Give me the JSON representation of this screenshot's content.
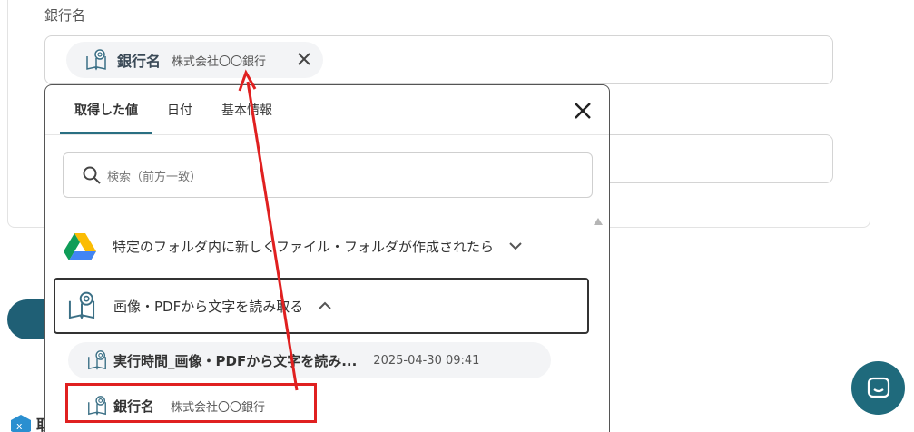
{
  "field": {
    "label": "銀行名",
    "chip": {
      "key": "銀行名",
      "value": "株式会社〇〇銀行"
    }
  },
  "popup": {
    "tabs": [
      "取得した値",
      "日付",
      "基本情報"
    ],
    "active_tab": "取得した値",
    "search_placeholder": "検索（前方一致）",
    "groups": [
      {
        "label": "特定のフォルダ内に新しくファイル・フォルダが作成されたら",
        "expanded": false
      },
      {
        "label": "画像・PDFから文字を読み取る",
        "expanded": true
      }
    ],
    "items": [
      {
        "key": "実行時間_画像・PDFから文字を読み...",
        "value": "2025-04-30 09:41"
      },
      {
        "key": "銀行名",
        "value": "株式会社〇〇銀行"
      }
    ]
  },
  "partial_text": "取",
  "colors": {
    "accent": "#2a6f82",
    "highlight": "#e02020",
    "chip_bg": "#f3f4f6"
  }
}
